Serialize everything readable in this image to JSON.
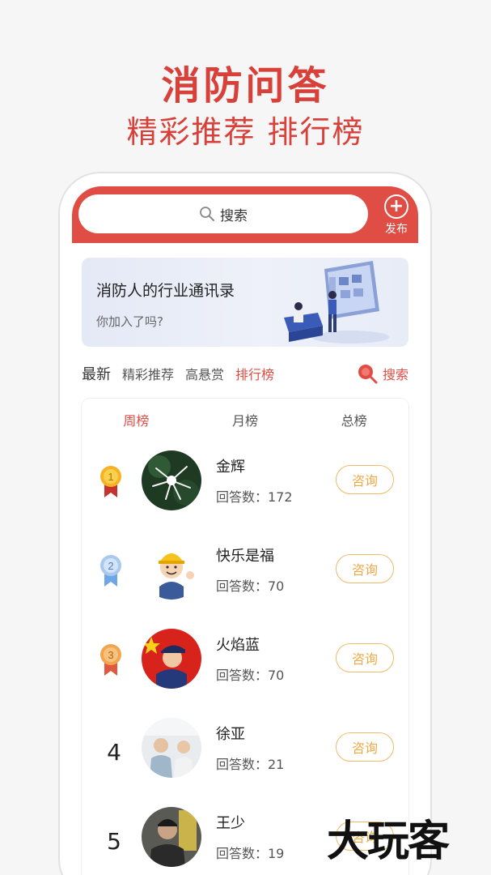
{
  "promo": {
    "title": "消防问答",
    "subtitle": "精彩推荐 排行榜"
  },
  "header": {
    "search_label": "搜索",
    "publish_label": "发布",
    "bg_color": "#df4d45"
  },
  "banner": {
    "title": "消防人的行业通讯录",
    "subtitle": "你加入了吗?"
  },
  "tabs": [
    {
      "label": "最新",
      "active": false
    },
    {
      "label": "精彩推荐",
      "active": false
    },
    {
      "label": "高悬赏",
      "active": false
    },
    {
      "label": "排行榜",
      "active": true
    }
  ],
  "tab_search_label": "搜索",
  "rank_tabs": [
    {
      "label": "周榜",
      "active": true
    },
    {
      "label": "月榜",
      "active": false
    },
    {
      "label": "总榜",
      "active": false
    }
  ],
  "rankings": [
    {
      "rank": "1",
      "medal": "gold-medal-icon",
      "name": "金辉",
      "answers": "回答数：172",
      "button": "咨询"
    },
    {
      "rank": "2",
      "medal": "silver-medal-icon",
      "name": "快乐是福",
      "answers": "回答数：70",
      "button": "咨询"
    },
    {
      "rank": "3",
      "medal": "bronze-medal-icon",
      "name": "火焰蓝",
      "answers": "回答数：70",
      "button": "咨询"
    },
    {
      "rank": "4",
      "medal": null,
      "name": "徐亚",
      "answers": "回答数：21",
      "button": "咨询"
    },
    {
      "rank": "5",
      "medal": null,
      "name": "王少",
      "answers": "回答数：19",
      "button": "咨询"
    }
  ],
  "watermark": "大玩客",
  "colors": {
    "accent": "#df4d45",
    "consult_border": "#f0b969"
  }
}
